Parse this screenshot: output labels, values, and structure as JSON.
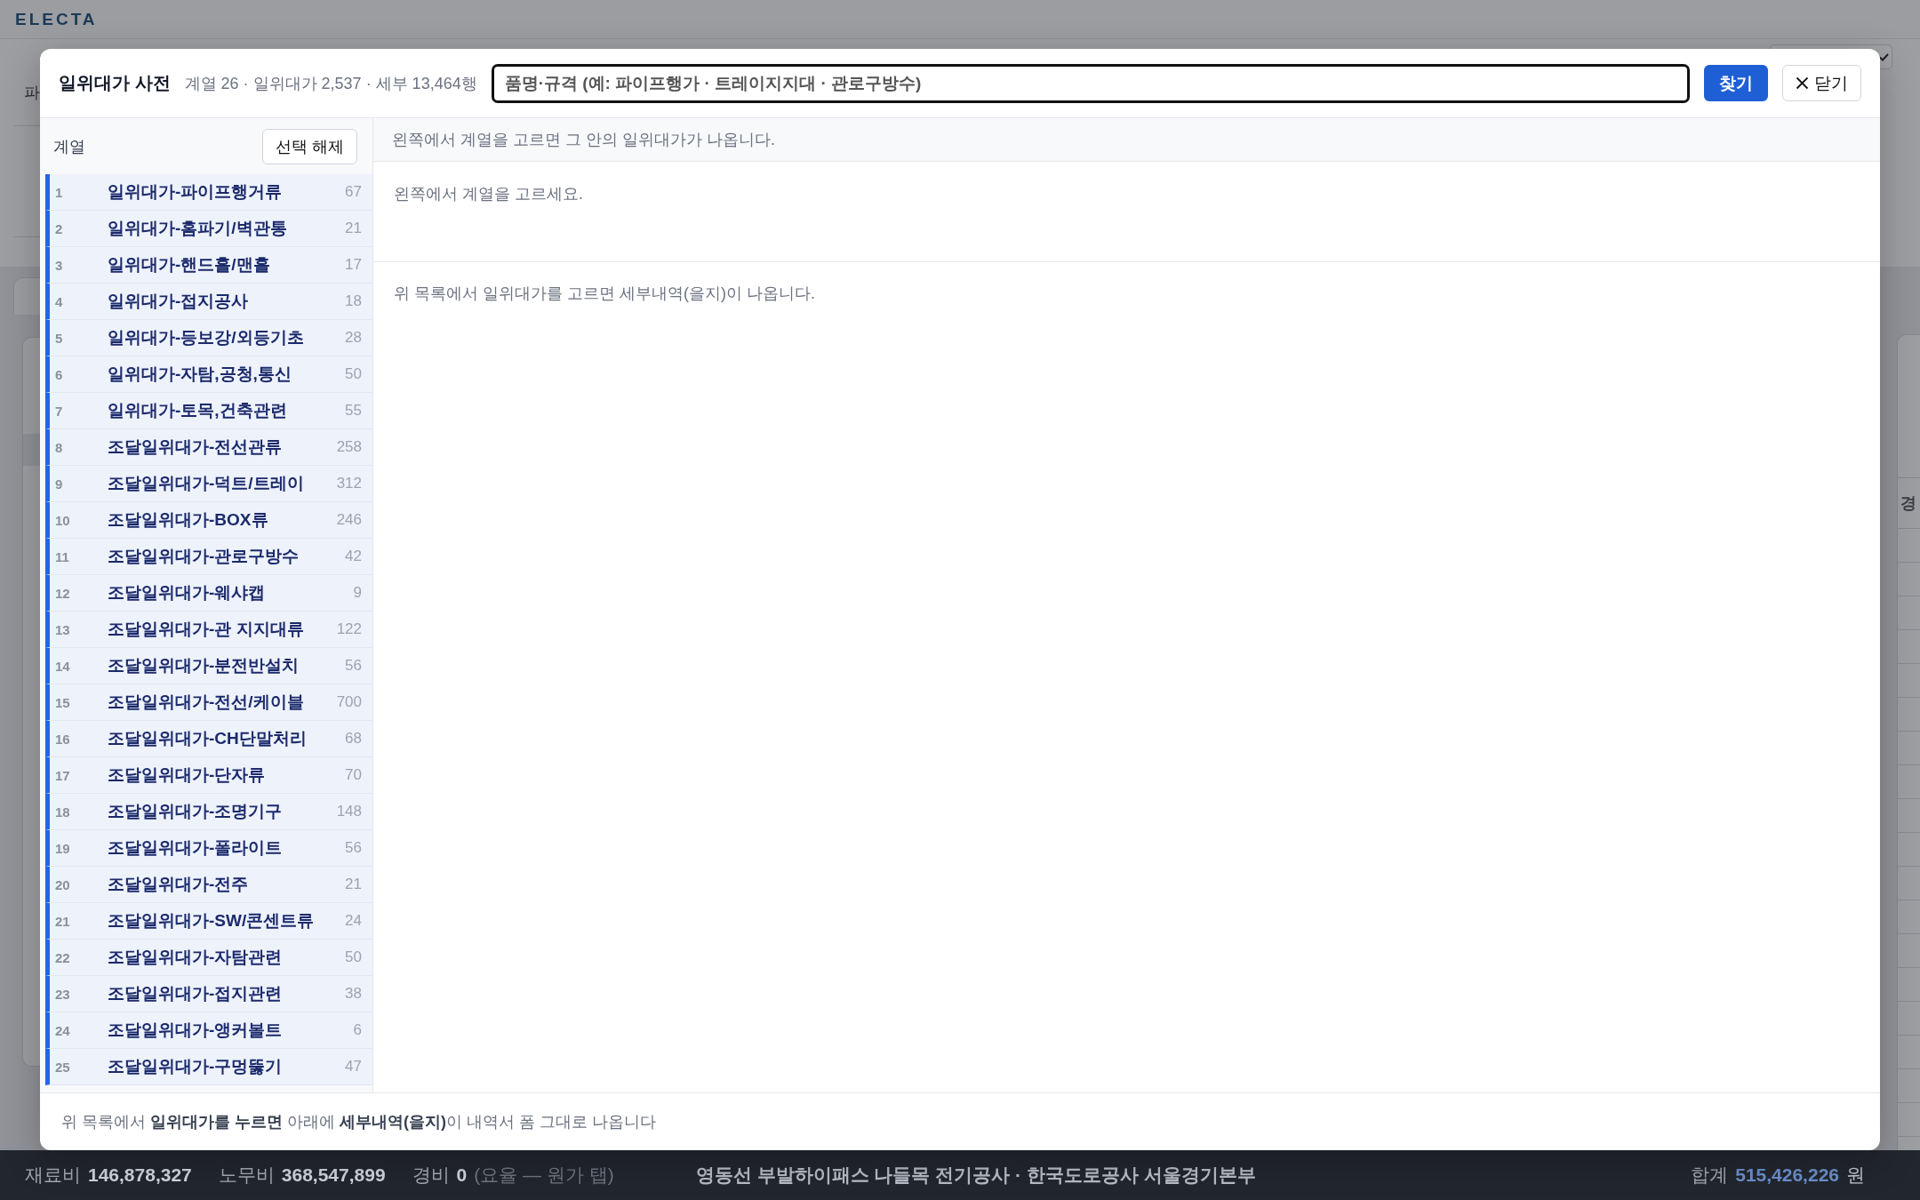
{
  "app_header": {
    "logo": "ELECTA"
  },
  "background": {
    "left_fragment": "파",
    "right_fragment": "경"
  },
  "dialog": {
    "title": "일위대가 사전",
    "summary": "계열 26 · 일위대가 2,537 · 세부 13,464행",
    "search": {
      "placeholder": "품명·규격 (예: 파이프행가 · 트레이지지대 · 관로구방수)"
    },
    "search_button": "찾기",
    "close_button": "닫기",
    "series_panel": {
      "heading": "계열",
      "clear_button": "선택 해제",
      "items": [
        {
          "number": "1",
          "name": "일위대가-파이프행거류",
          "count": "67",
          "selected": false
        },
        {
          "number": "2",
          "name": "일위대가-홈파기/벽관통",
          "count": "21",
          "selected": false
        },
        {
          "number": "3",
          "name": "일위대가-핸드홀/맨홀",
          "count": "17",
          "selected": false
        },
        {
          "number": "4",
          "name": "일위대가-접지공사",
          "count": "18",
          "selected": false
        },
        {
          "number": "5",
          "name": "일위대가-등보강/외등기초",
          "count": "28",
          "selected": false
        },
        {
          "number": "6",
          "name": "일위대가-자탐,공청,통신",
          "count": "50",
          "selected": false
        },
        {
          "number": "7",
          "name": "일위대가-토목,건축관련",
          "count": "55",
          "selected": false
        },
        {
          "number": "8",
          "name": "조달일위대가-전선관류",
          "count": "258",
          "selected": false
        },
        {
          "number": "9",
          "name": "조달일위대가-덕트/트레이",
          "count": "312",
          "selected": false
        },
        {
          "number": "10",
          "name": "조달일위대가-BOX류",
          "count": "246",
          "selected": false
        },
        {
          "number": "11",
          "name": "조달일위대가-관로구방수",
          "count": "42",
          "selected": false
        },
        {
          "number": "12",
          "name": "조달일위대가-웨샤캡",
          "count": "9",
          "selected": false
        },
        {
          "number": "13",
          "name": "조달일위대가-관 지지대류",
          "count": "122",
          "selected": false
        },
        {
          "number": "14",
          "name": "조달일위대가-분전반설치",
          "count": "56",
          "selected": false
        },
        {
          "number": "15",
          "name": "조달일위대가-전선/케이블",
          "count": "700",
          "selected": false
        },
        {
          "number": "16",
          "name": "조달일위대가-CH단말처리",
          "count": "68",
          "selected": false
        },
        {
          "number": "17",
          "name": "조달일위대가-단자류",
          "count": "70",
          "selected": false
        },
        {
          "number": "18",
          "name": "조달일위대가-조명기구",
          "count": "148",
          "selected": false
        },
        {
          "number": "19",
          "name": "조달일위대가-폴라이트",
          "count": "56",
          "selected": false
        },
        {
          "number": "20",
          "name": "조달일위대가-전주",
          "count": "21",
          "selected": false
        },
        {
          "number": "21",
          "name": "조달일위대가-SW/콘센트류",
          "count": "24",
          "selected": false
        },
        {
          "number": "22",
          "name": "조달일위대가-자탐관련",
          "count": "50",
          "selected": false
        },
        {
          "number": "23",
          "name": "조달일위대가-접지관련",
          "count": "38",
          "selected": false
        },
        {
          "number": "24",
          "name": "조달일위대가-앵커볼트",
          "count": "6",
          "selected": false
        },
        {
          "number": "25",
          "name": "조달일위대가-구멍뚫기",
          "count": "47",
          "selected": false
        }
      ]
    },
    "detail_panel": {
      "hint": "왼쪽에서 계열을 고르면 그 안의 일위대가가 나옵니다.",
      "empty_message": "왼쪽에서 계열을 고르세요.",
      "detail_message": "위 목록에서 일위대가를 고르면 세부내역(을지)이 나옵니다."
    },
    "footer_note": "위 목록에서 **일위대가를 누르면** 아래에 **세부내역(을지)**이 내역서 폼 그대로 나옵니다"
  },
  "status_bar": {
    "totals": [
      {
        "label": "재료비",
        "value": "146,878,327"
      },
      {
        "label": "노무비",
        "value": "368,547,899"
      },
      {
        "label": "경비",
        "value": "0",
        "note": "(요율 — 원가 탭)"
      }
    ],
    "project": "영동선 부발하이패스 나들목 전기공사 · 한국도로공사 서울경기본부",
    "grand_total": {
      "label": "합계",
      "value": "515,426,226",
      "unit": "원"
    }
  }
}
